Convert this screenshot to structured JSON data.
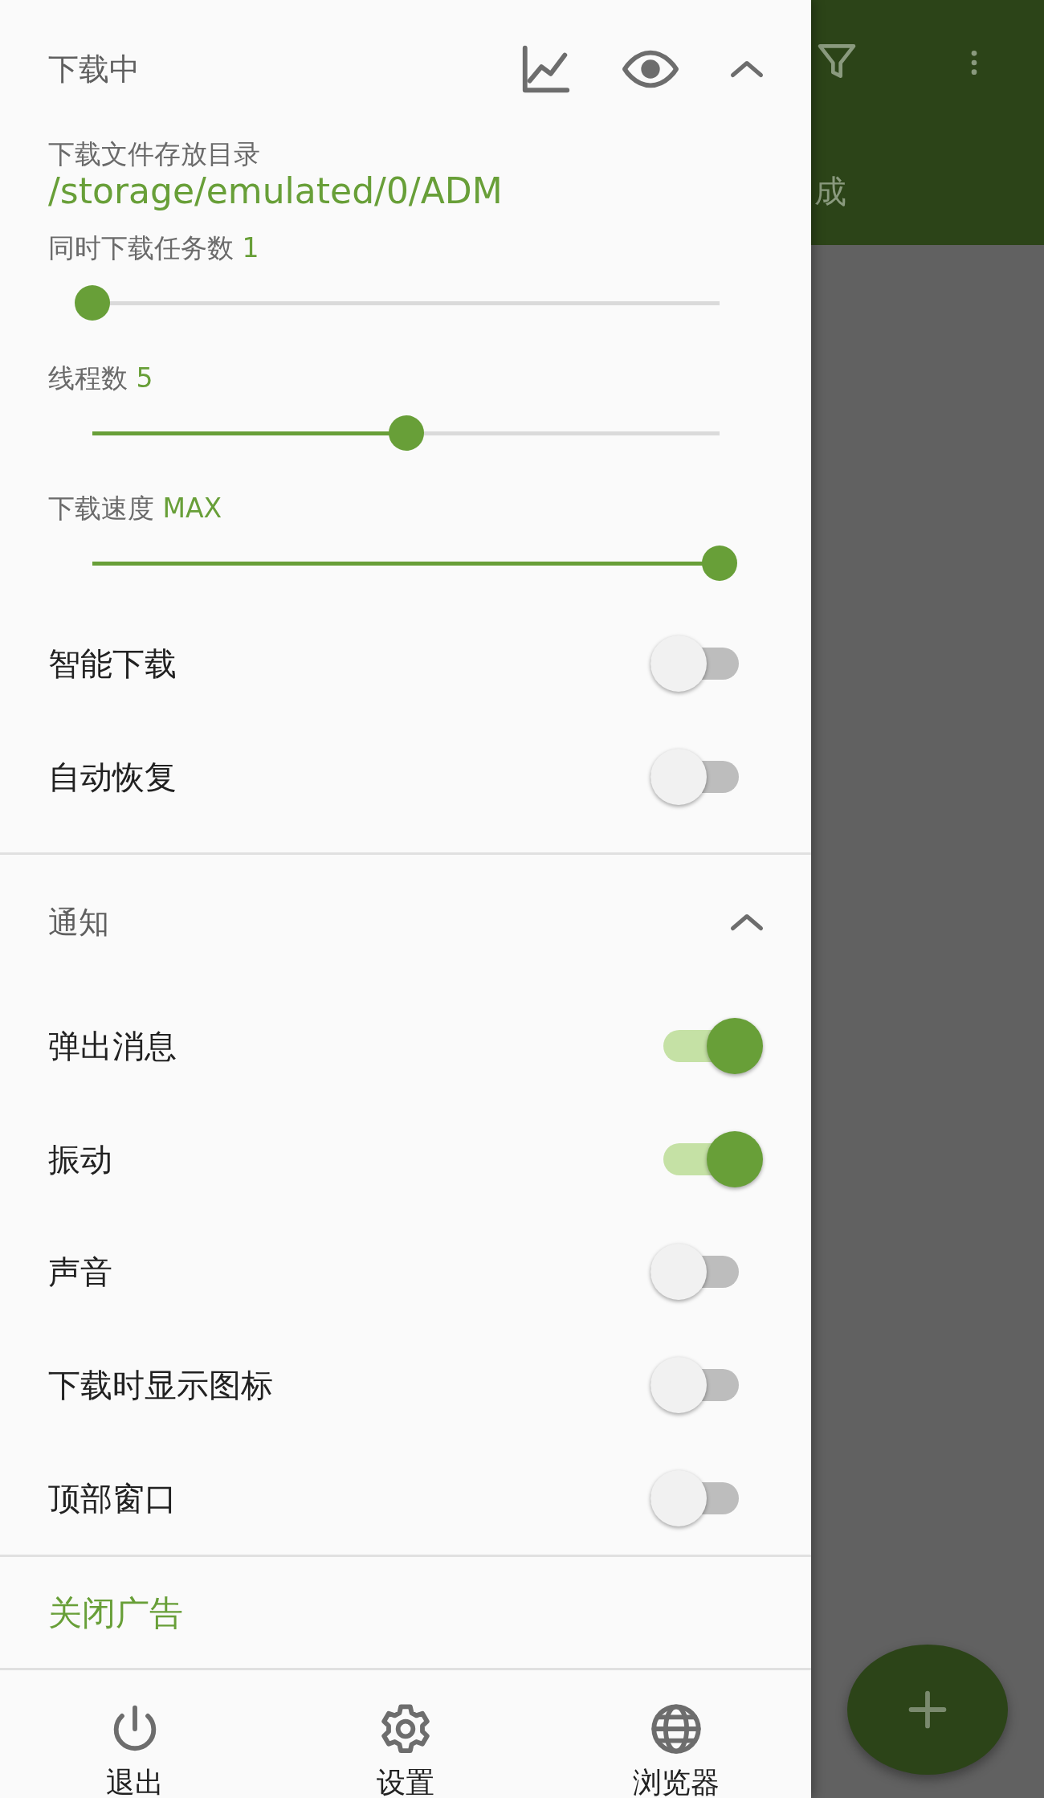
{
  "header": {
    "title": "下载中",
    "expanded": true
  },
  "download_dir": {
    "label": "下载文件存放目录",
    "value": "/storage/emulated/0/ADM"
  },
  "sliders": [
    {
      "label": "同时下载任务数",
      "reading": "1",
      "level": 0
    },
    {
      "label": "线程数",
      "reading": "5",
      "level": 0.5
    },
    {
      "label": "下载速度",
      "reading": "MAX",
      "level": 1
    }
  ],
  "download_switches": [
    {
      "label": "智能下载",
      "on": false
    },
    {
      "label": "自动恢复",
      "on": false
    }
  ],
  "notifications": {
    "title": "通知",
    "expanded": true,
    "switches": [
      {
        "label": "弹出消息",
        "on": true
      },
      {
        "label": "振动",
        "on": true
      },
      {
        "label": "声音",
        "on": false
      },
      {
        "label": "下载时显示图标",
        "on": false
      },
      {
        "label": "顶部窗口",
        "on": false
      }
    ]
  },
  "close_ads": "关闭广告",
  "bottom_nav": [
    {
      "label": "退出",
      "kind": "power"
    },
    {
      "label": "设置",
      "kind": "settings"
    },
    {
      "label": "浏览器",
      "kind": "globe"
    }
  ],
  "background": {
    "tab_fragment": "成"
  }
}
